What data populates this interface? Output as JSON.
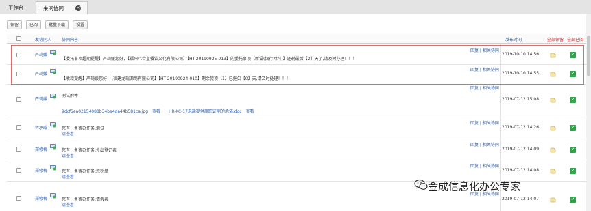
{
  "tabs": [
    {
      "label": "工作台"
    },
    {
      "label": "未阅协同"
    }
  ],
  "toolbar": {
    "buttons": [
      "保留",
      "已阅",
      "批量下载",
      "设置"
    ]
  },
  "columns": {
    "sender": "发协同人",
    "content": "协同内容",
    "time": "发布时间",
    "keep_all": "全部保留",
    "read_all": "全部已阅"
  },
  "rows": [
    {
      "sender": "严琦媛",
      "content_line1": "",
      "content_line2": "【委托事项超期提醒】严琦媛您好，【福州八合皇餐饮文化有限公司】【HT-20190925-013】的委托事项【新设(银行材料)】还剩最后【2】天了,请及时办理！！！",
      "attachments": [],
      "reply": "回复 | 相关协同",
      "time": "2019-10-10 14:56"
    },
    {
      "sender": "严琦媛",
      "content_line1": "",
      "content_line2": "【收款提醒】严琦媛您好，【福建龙瑞源商有限公司】【HT-20190924-010】剩余款项【1】已拖欠【0】天,请及时处理！！！",
      "attachments": [],
      "reply": "回复 | 相关协同",
      "time": "2019-10-10 14:55"
    },
    {
      "sender": "严琦媛",
      "content_line1": "测试附件",
      "content_line2": "",
      "attachments": [
        "9dcf5ea02154088b34be4da44b581ca.jpg",
        "查看",
        "HR-XC-17未能提供离职证明的承诺.doc",
        "查看"
      ],
      "reply": "回复 | 相关协同",
      "time": "2019-07-12 15:08"
    },
    {
      "sender": "林承威",
      "content_line1": "您有一条待办任务:测试",
      "content_line2": "请查看",
      "attachments": [],
      "reply": "回复 | 相关协同",
      "time": "2019-07-12 14:26"
    },
    {
      "sender": "郑修梅",
      "content_line1": "您有一条待办任务:外出登记表",
      "content_line2": "请查看",
      "attachments": [],
      "reply": "回复 | 相关协同",
      "time": "2019-07-12 14:09"
    },
    {
      "sender": "郑修梅",
      "content_line1": "您有一条待办任务:惩罚单",
      "content_line2": "请查看",
      "attachments": [],
      "reply": "回复 | 相关协同",
      "time": "2019-07-12 14:08"
    },
    {
      "sender": "郑修梅",
      "content_line1": "您有一条待办任务:请假表",
      "content_line2": "请查看",
      "attachments": [],
      "reply": "回复 | 相关协同",
      "time": "2019-07-12 14:07"
    }
  ],
  "watermark": "金成信息化办公专家",
  "colors": {
    "link": "#2f5fa8",
    "header_red": "#d02020",
    "check_green": "#2fa64a",
    "highlight_border": "#e06a6a"
  }
}
